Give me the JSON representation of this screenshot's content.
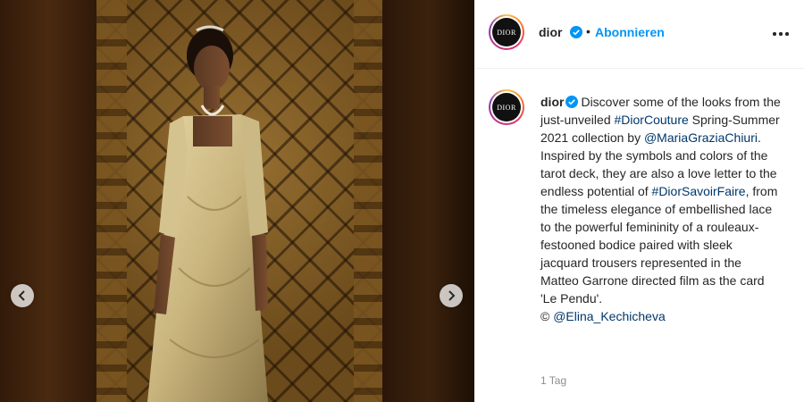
{
  "post": {
    "username": "dior",
    "follow_label": "Abonnieren",
    "separator": "•",
    "avatar_text": "DIOR",
    "caption": {
      "p1": "Discover some of the looks from the just-unveiled ",
      "tag1": "#DiorCouture",
      "p2": " Spring-Summer 2021 collection by ",
      "mention1": "@MariaGraziaChiuri",
      "p3": ". Inspired by the symbols and colors of the tarot deck, they are also a love letter to the endless potential of ",
      "tag2": "#DiorSavoirFaire",
      "p4": ", from the timeless elegance of embellished lace to the powerful femininity of a rouleaux-festooned bodice paired with sleek jacquard trousers represented in the Matteo Garrone directed film as the card 'Le Pendu'.",
      "p5": "© ",
      "mention2": "@Elina_Kechicheva"
    },
    "timestamp": "1 Tag"
  },
  "icons": {
    "verified": "verified-badge-icon",
    "more": "more-options-icon",
    "prev": "chevron-left-icon",
    "next": "chevron-right-icon"
  },
  "colors": {
    "link": "#00376b",
    "follow": "#0095f6",
    "verified": "#0095f6"
  }
}
